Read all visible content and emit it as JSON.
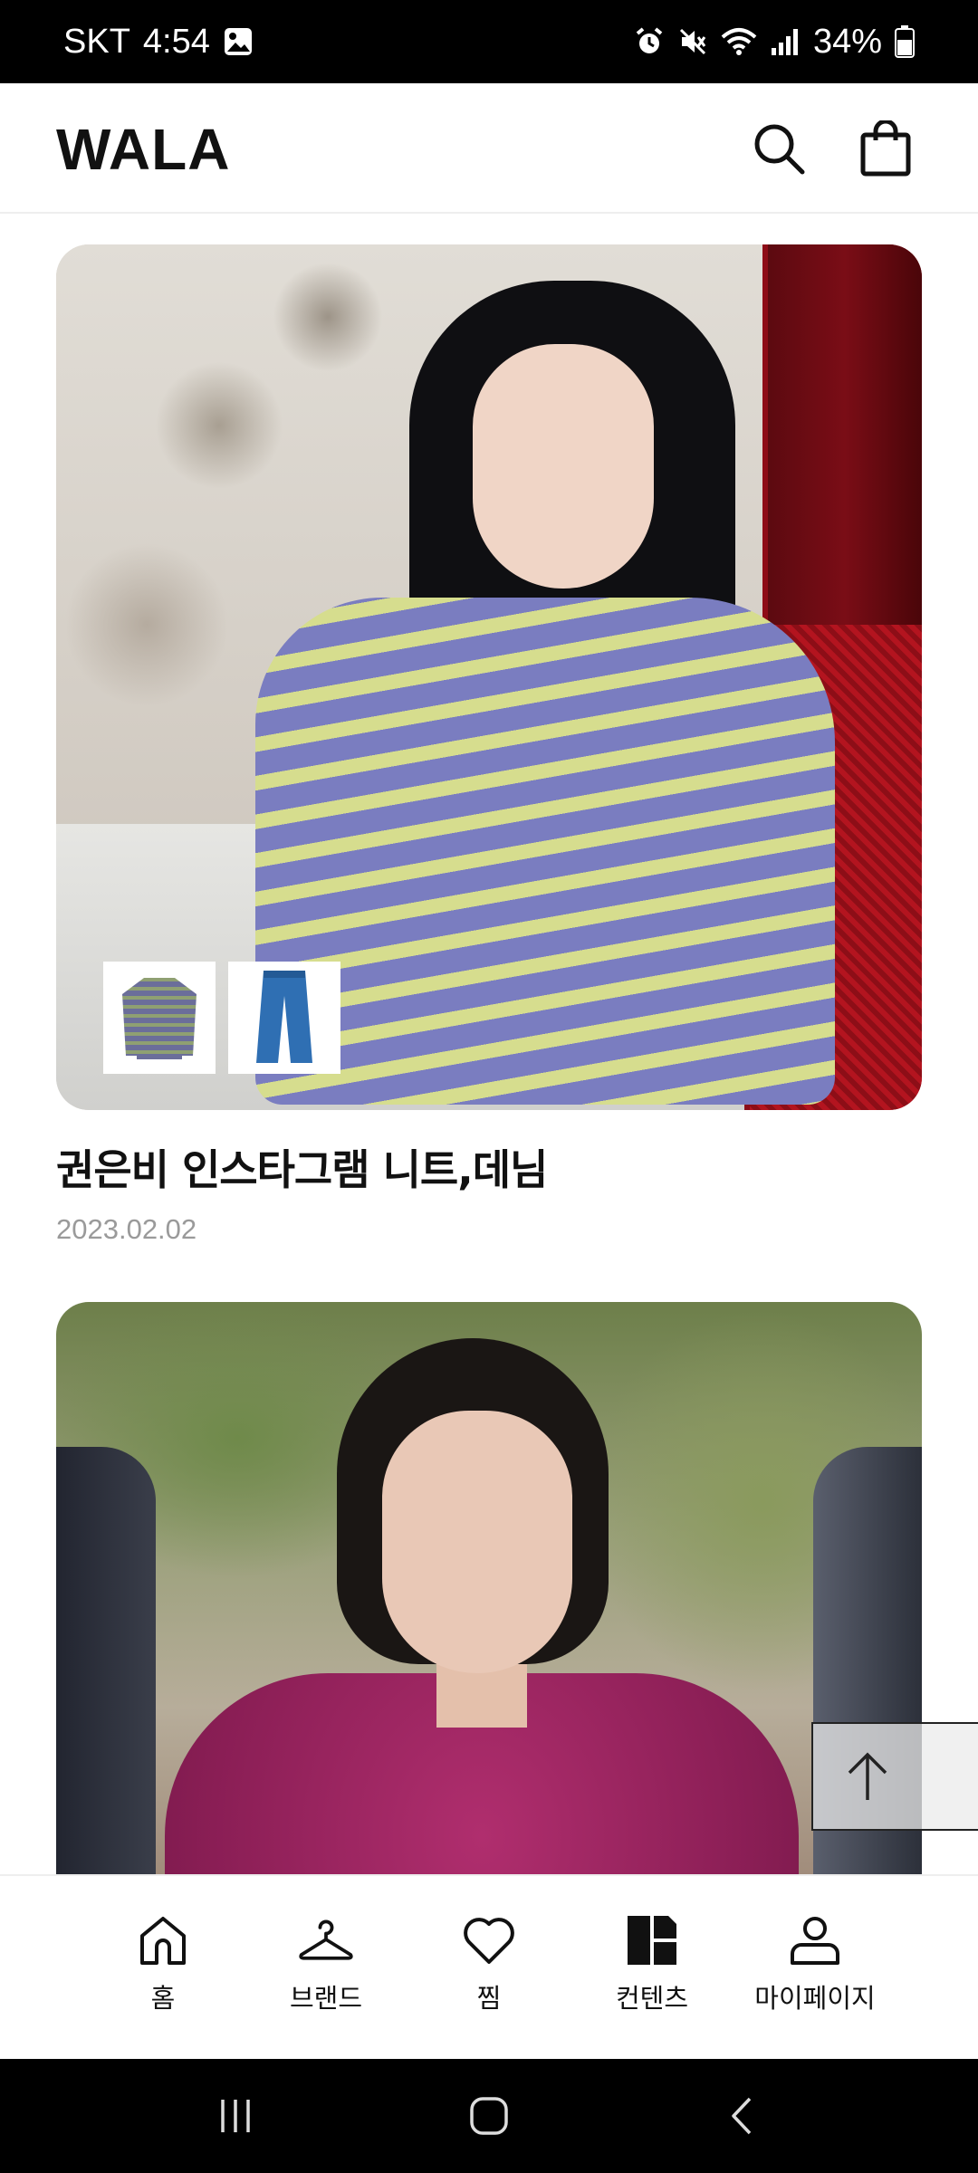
{
  "status_bar": {
    "carrier": "SKT",
    "time": "4:54",
    "battery": "34%",
    "icons": [
      "gallery-icon",
      "alarm-icon",
      "mute-icon",
      "wifi-icon",
      "signal-icon",
      "battery-icon"
    ]
  },
  "header": {
    "logo": "WALA",
    "icons": [
      "search-icon",
      "shopping-bag-icon"
    ]
  },
  "cards": [
    {
      "title": "권은비 인스타그램 니트,데님",
      "date": "2023.02.02",
      "product_thumbnails": [
        "striped-knit-sweater",
        "denim-pants"
      ]
    },
    {
      "title": "",
      "date": ""
    }
  ],
  "scroll_top_icon": "arrow-up-icon",
  "bottom_nav": {
    "items": [
      {
        "label": "홈",
        "icon": "home-icon"
      },
      {
        "label": "브랜드",
        "icon": "hanger-icon"
      },
      {
        "label": "찜",
        "icon": "heart-icon"
      },
      {
        "label": "컨텐츠",
        "icon": "content-grid-icon"
      },
      {
        "label": "마이페이지",
        "icon": "user-icon"
      }
    ]
  },
  "system_nav": [
    "recent-apps-icon",
    "home-circle-icon",
    "back-icon"
  ]
}
